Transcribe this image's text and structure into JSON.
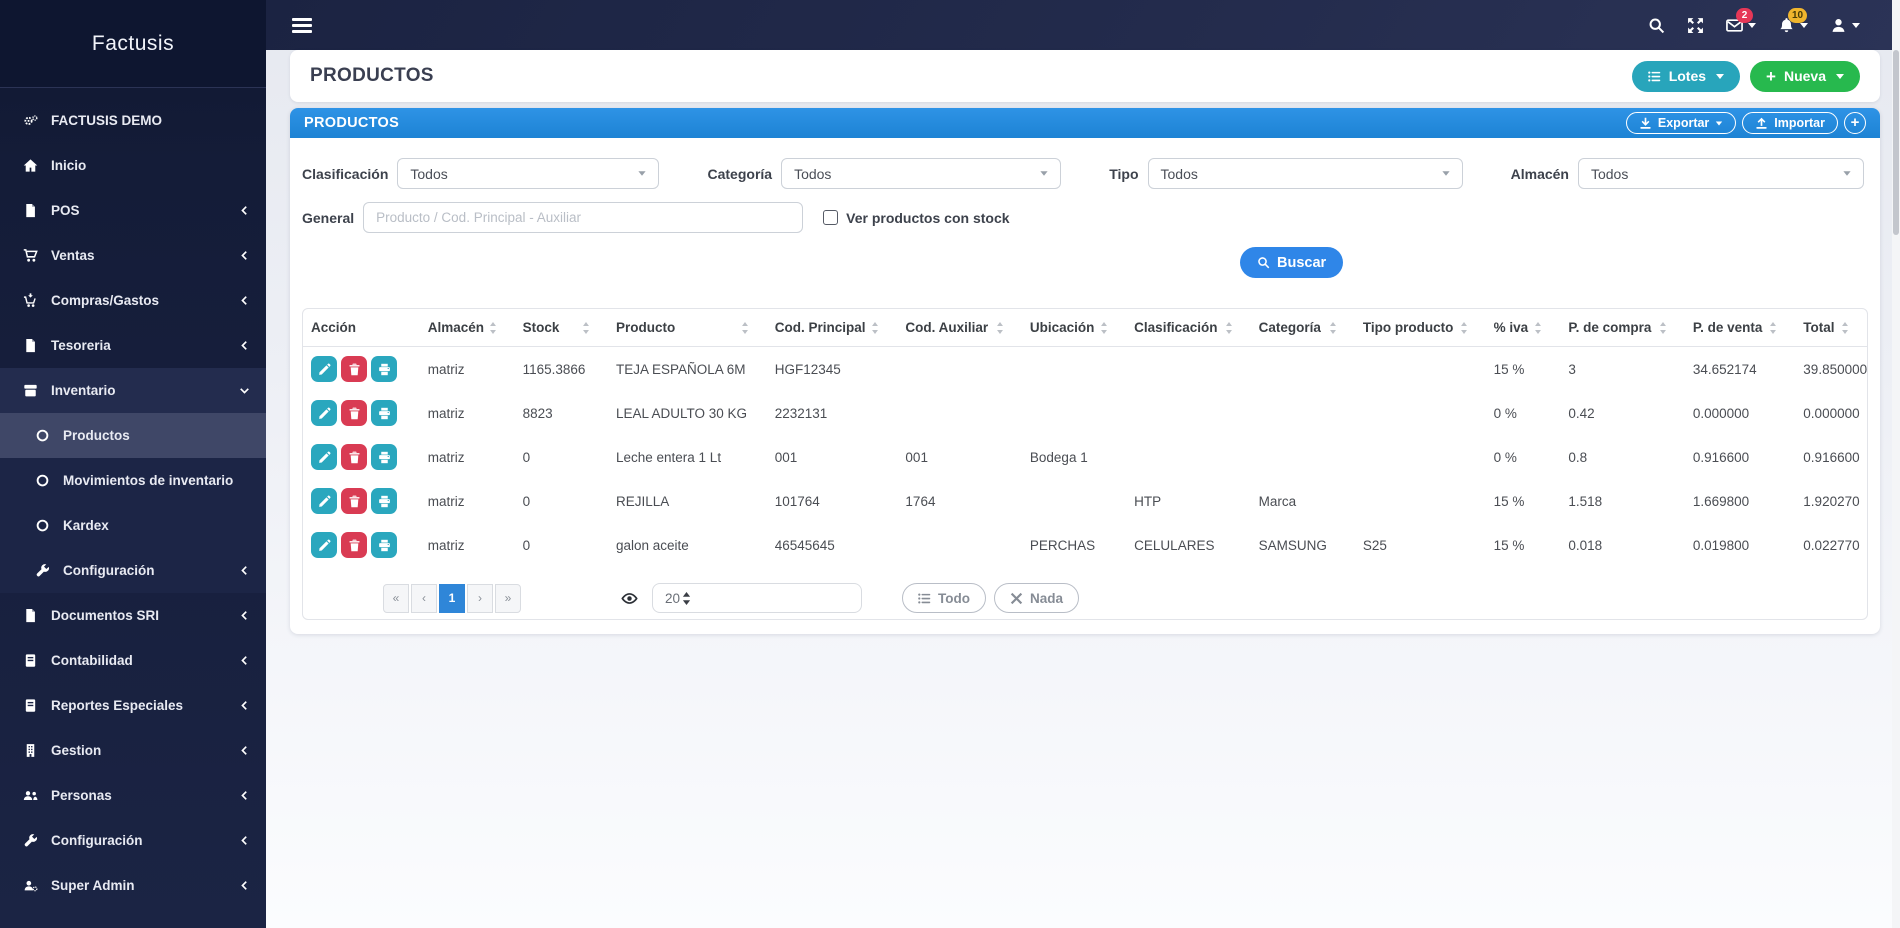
{
  "brand": {
    "name": "Factusis"
  },
  "topbar": {
    "mail_badge": "2",
    "bell_badge": "10"
  },
  "sidebar": {
    "items": [
      {
        "label": "FACTUSIS DEMO",
        "icon": "gears-icon",
        "chevron": ""
      },
      {
        "label": "Inicio",
        "icon": "home-icon",
        "chevron": ""
      },
      {
        "label": "POS",
        "icon": "file-icon",
        "chevron": "left"
      },
      {
        "label": "Ventas",
        "icon": "cart-icon",
        "chevron": "left"
      },
      {
        "label": "Compras/Gastos",
        "icon": "cart-arrow-icon",
        "chevron": "left"
      },
      {
        "label": "Tesoreria",
        "icon": "file-icon",
        "chevron": "left"
      },
      {
        "label": "Inventario",
        "icon": "box-icon",
        "chevron": "down",
        "open": true,
        "children": [
          {
            "label": "Productos",
            "icon": "radio-circle-icon",
            "active": true
          },
          {
            "label": "Movimientos de inventario",
            "icon": "radio-circle-icon"
          },
          {
            "label": "Kardex",
            "icon": "radio-circle-icon"
          },
          {
            "label": "Configuración",
            "icon": "wrench-icon",
            "chevron": "left"
          }
        ]
      },
      {
        "label": "Documentos SRI",
        "icon": "file-icon",
        "chevron": "left"
      },
      {
        "label": "Contabilidad",
        "icon": "book-icon",
        "chevron": "left"
      },
      {
        "label": "Reportes Especiales",
        "icon": "book-icon",
        "chevron": "left"
      },
      {
        "label": "Gestion",
        "icon": "building-icon",
        "chevron": "left"
      },
      {
        "label": "Personas",
        "icon": "users-icon",
        "chevron": "left"
      },
      {
        "label": "Configuración",
        "icon": "wrench-icon",
        "chevron": "left"
      },
      {
        "label": "Super Admin",
        "icon": "user-gear-icon",
        "chevron": "left"
      }
    ]
  },
  "page": {
    "title": "PRODUCTOS",
    "lotes_label": "Lotes",
    "nueva_label": "Nueva"
  },
  "panel": {
    "title": "PRODUCTOS",
    "exportar_label": "Exportar",
    "importar_label": "Importar",
    "add_label": "+"
  },
  "filters": {
    "clasificacion": {
      "label": "Clasificación",
      "value": "Todos"
    },
    "categoria": {
      "label": "Categoría",
      "value": "Todos"
    },
    "tipo": {
      "label": "Tipo",
      "value": "Todos"
    },
    "almacen": {
      "label": "Almacén",
      "value": "Todos"
    },
    "general": {
      "label": "General",
      "placeholder": "Producto / Cod. Principal - Auxiliar",
      "value": ""
    },
    "stock_checkbox_label": "Ver productos con stock",
    "buscar_label": "Buscar"
  },
  "table": {
    "headers": [
      "Acción",
      "Almacén",
      "Stock",
      "Producto",
      "Cod. Principal",
      "Cod. Auxiliar",
      "Ubicación",
      "Clasificación",
      "Categoría",
      "Tipo producto",
      "% iva",
      "P. de compra",
      "P. de venta",
      "Total"
    ],
    "rows": [
      [
        "matriz",
        "1165.3866",
        "TEJA ESPAÑOLA 6M",
        "HGF12345",
        "",
        "",
        "",
        "",
        "",
        "15 %",
        "3",
        "34.652174",
        "39.850000"
      ],
      [
        "matriz",
        "8823",
        "LEAL ADULTO 30 KG",
        "2232131",
        "",
        "",
        "",
        "",
        "",
        "0 %",
        "0.42",
        "0.000000",
        "0.000000"
      ],
      [
        "matriz",
        "0",
        "Leche entera 1 Lt",
        "001",
        "001",
        "Bodega 1",
        "",
        "",
        "",
        "0 %",
        "0.8",
        "0.916600",
        "0.916600"
      ],
      [
        "matriz",
        "0",
        "REJILLA",
        "101764",
        "1764",
        "",
        "HTP",
        "Marca",
        "",
        "15 %",
        "1.518",
        "1.669800",
        "1.920270"
      ],
      [
        "matriz",
        "0",
        "galon aceite",
        "46545645",
        "",
        "PERCHAS",
        "CELULARES",
        "SAMSUNG",
        "S25",
        "15 %",
        "0.018",
        "0.019800",
        "0.022770"
      ]
    ]
  },
  "pagination": {
    "first": "«",
    "prev": "‹",
    "pages": [
      "1"
    ],
    "active_page": "1",
    "next": "›",
    "last": "»",
    "page_size": "20",
    "todo_label": "Todo",
    "nada_label": "Nada"
  },
  "colors": {
    "accent_blue": "#2387dd",
    "teal": "#28a5bb",
    "green": "#27b94e",
    "red": "#d93b53",
    "navy": "#1b2342"
  }
}
